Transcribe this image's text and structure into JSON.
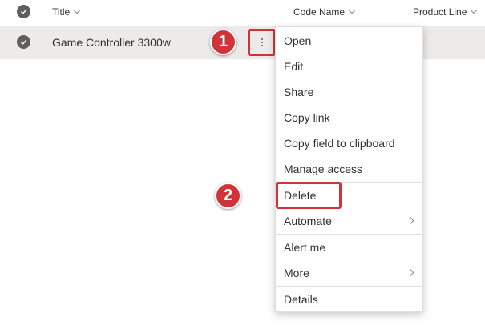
{
  "header": {
    "columns": {
      "title": "Title",
      "code_name": "Code Name",
      "product_line": "Product Line"
    }
  },
  "row": {
    "title": "Game Controller 3300w"
  },
  "annotations": {
    "step1": "1",
    "step2": "2",
    "accent_color": "#d13438"
  },
  "context_menu": {
    "items": {
      "open": "Open",
      "edit": "Edit",
      "share": "Share",
      "copy_link": "Copy link",
      "copy_field": "Copy field to clipboard",
      "manage_access": "Manage access",
      "delete": "Delete",
      "automate": "Automate",
      "alert_me": "Alert me",
      "more": "More",
      "details": "Details"
    }
  },
  "icons": {
    "select_all": "check-circle-icon",
    "row_select": "check-circle-icon",
    "more_actions": "vertical-ellipsis-icon",
    "submenu": "chevron-right-icon",
    "sort": "chevron-down-icon"
  }
}
